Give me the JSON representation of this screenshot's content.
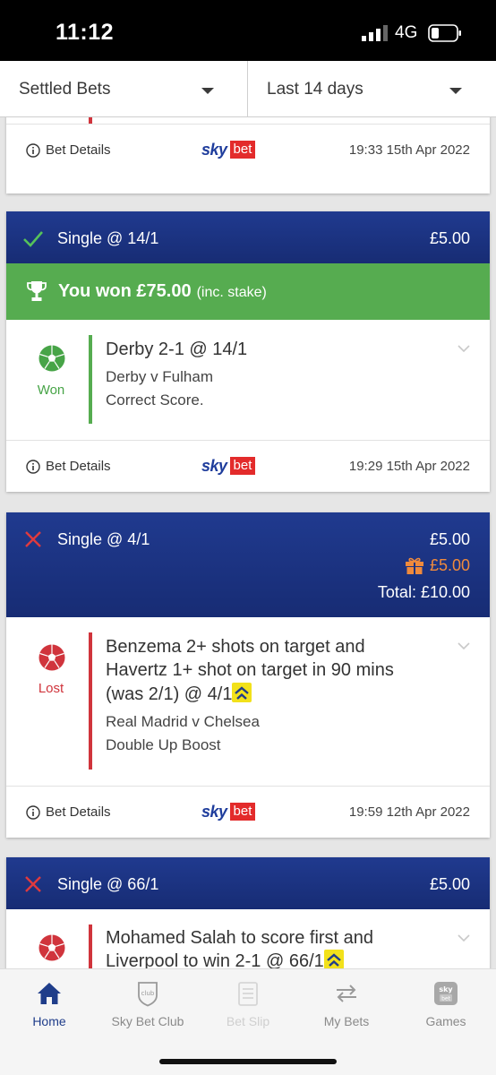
{
  "statusbar": {
    "time": "11:12",
    "network": "4G"
  },
  "filters": {
    "type": "Settled Bets",
    "period": "Last 14 days"
  },
  "colors": {
    "brand_blue": "#1f3d9c",
    "won_green": "#56ac50",
    "lost_red": "#d0343c",
    "bonus_orange": "#f08a3c"
  },
  "common": {
    "bet_details": "Bet Details",
    "logo_sky": "sky",
    "logo_bet": "bet"
  },
  "bets": [
    {
      "datetime": "19:33 15th Apr 2022"
    },
    {
      "status": "won",
      "bet_type": "Single @ 14/1",
      "stake": "£5.00",
      "won_text": "You won £75.00",
      "won_note": "(inc. stake)",
      "selection": {
        "title": "Derby 2-1 @ 14/1",
        "event": "Derby v Fulham",
        "market": "Correct Score.",
        "result": "Won"
      },
      "datetime": "19:29 15th Apr 2022"
    },
    {
      "status": "lost",
      "bet_type": "Single @ 4/1",
      "stake": "£5.00",
      "bonus": "£5.00",
      "total": "Total: £10.00",
      "selection": {
        "title_lines": [
          "Benzema 2+ shots on target and",
          "Havertz 1+ shot on target in 90 mins",
          "(was 2/1) @ 4/1"
        ],
        "event": "Real Madrid v Chelsea",
        "market": "Double Up Boost",
        "result": "Lost"
      },
      "datetime": "19:59 12th Apr 2022"
    },
    {
      "status": "lost",
      "bet_type": "Single @ 66/1",
      "stake": "£5.00",
      "selection": {
        "title_lines": [
          "Mohamed Salah to score first and",
          "Liverpool to win 2-1 @ 66/1"
        ]
      }
    }
  ],
  "nav": [
    {
      "label": "Home",
      "icon": "home-icon",
      "state": "active"
    },
    {
      "label": "Sky Bet Club",
      "icon": "club-icon",
      "state": "normal"
    },
    {
      "label": "Bet Slip",
      "icon": "betslip-icon",
      "state": "disabled"
    },
    {
      "label": "My Bets",
      "icon": "mybets-icon",
      "state": "normal"
    },
    {
      "label": "Games",
      "icon": "games-icon",
      "state": "normal"
    }
  ]
}
